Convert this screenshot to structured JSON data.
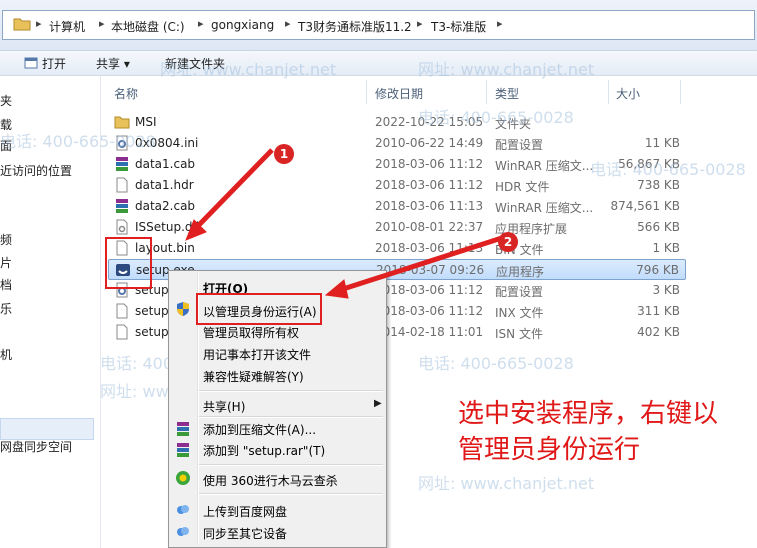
{
  "address": {
    "crumbs": [
      "计算机",
      "本地磁盘 (C:)",
      "gongxiang",
      "T3财务通标准版11.2",
      "T3-标准版"
    ]
  },
  "toolbar": {
    "open": "打开",
    "share": "共享 ▾",
    "new_folder": "新建文件夹"
  },
  "nav": {
    "items": [
      "夹",
      "载",
      "面",
      "近访问的位置",
      "频",
      "片",
      "档",
      "乐",
      "机",
      "网盘同步空间"
    ]
  },
  "columns": {
    "name": "名称",
    "date": "修改日期",
    "type": "类型",
    "size": "大小"
  },
  "files": [
    {
      "name": "MSI",
      "date": "2022-10-22 15:05",
      "type": "文件夹",
      "size": ""
    },
    {
      "name": "0x0804.ini",
      "date": "2010-06-22 14:49",
      "type": "配置设置",
      "size": "11 KB"
    },
    {
      "name": "data1.cab",
      "date": "2018-03-06 11:12",
      "type": "WinRAR 压缩文...",
      "size": "56,867 KB"
    },
    {
      "name": "data1.hdr",
      "date": "2018-03-06 11:12",
      "type": "HDR 文件",
      "size": "738 KB"
    },
    {
      "name": "data2.cab",
      "date": "2018-03-06 11:13",
      "type": "WinRAR 压缩文...",
      "size": "874,561 KB"
    },
    {
      "name": "ISSetup.dll",
      "date": "2010-08-01 22:37",
      "type": "应用程序扩展",
      "size": "566 KB"
    },
    {
      "name": "layout.bin",
      "date": "2018-03-06 11:13",
      "type": "BIN 文件",
      "size": "1 KB"
    },
    {
      "name": "setup.exe",
      "date": "2018-03-07 09:26",
      "type": "应用程序",
      "size": "796 KB"
    },
    {
      "name": "setup",
      "date": "2018-03-06 11:12",
      "type": "配置设置",
      "size": "3 KB"
    },
    {
      "name": "setup",
      "date": "2018-03-06 11:12",
      "type": "INX 文件",
      "size": "311 KB"
    },
    {
      "name": "setup",
      "date": "2014-02-18 11:01",
      "type": "ISN 文件",
      "size": "402 KB"
    }
  ],
  "menu": {
    "open": "打开(O)",
    "run_as_admin": "以管理员身份运行(A)",
    "take_ownership": "管理员取得所有权",
    "open_notepad": "用记事本打开该文件",
    "compat": "兼容性疑难解答(Y)",
    "share": "共享(H)",
    "add_archive": "添加到压缩文件(A)...",
    "add_rar": "添加到 \"setup.rar\"(T)",
    "scan_360": "使用 360进行木马云查杀",
    "upload_baidu": "上传到百度网盘",
    "sync_device": "同步至其它设备"
  },
  "watermark": {
    "phone": "电话: 400-665-0028",
    "site": "网址: www.chanjet.net"
  },
  "annotation": {
    "badge1": "1",
    "badge2": "2",
    "text_line1": "选中安装程序，右键以",
    "text_line2": "管理员身份运行"
  },
  "colors": {
    "accent_red": "#e02020",
    "selection": "#c1dcfc"
  }
}
